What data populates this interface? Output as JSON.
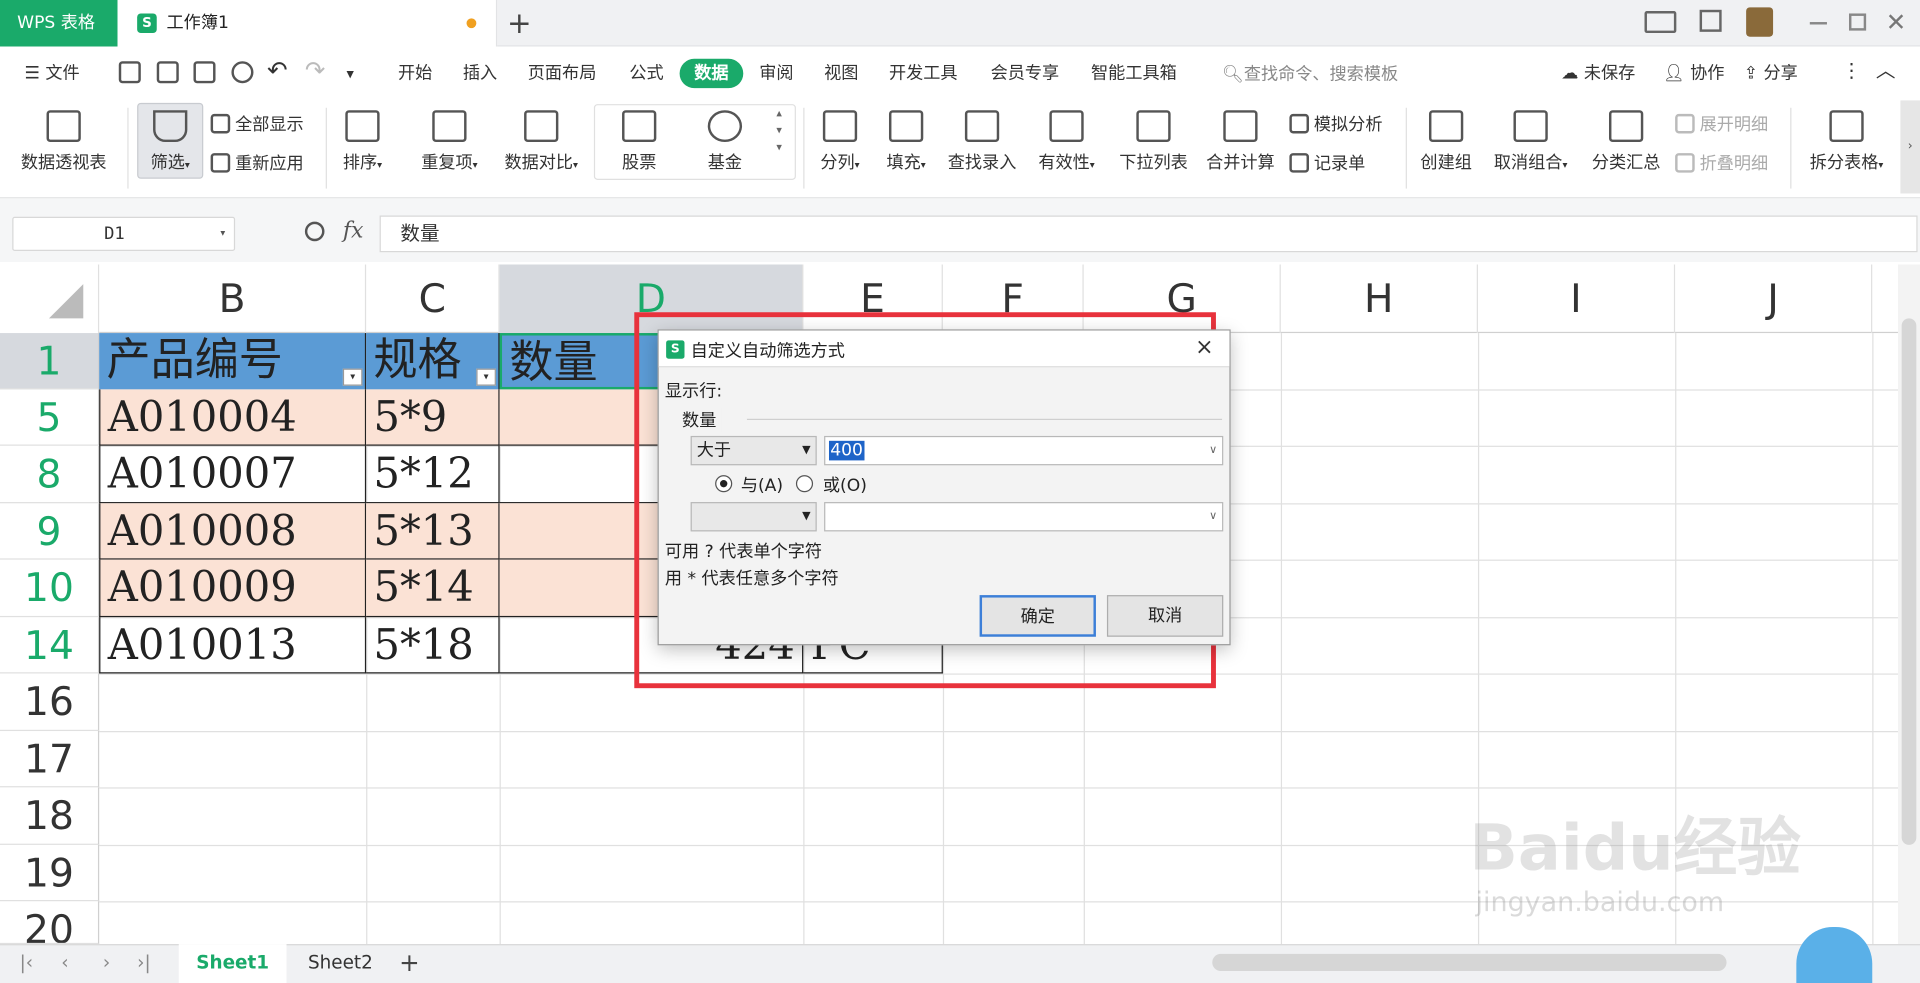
{
  "titlebar": {
    "app_tab": "WPS 表格",
    "doc_tab": "工作簿1",
    "new_tab": "+",
    "doc_icon": "S"
  },
  "menu": {
    "file": "文件",
    "items": [
      "开始",
      "插入",
      "页面布局",
      "公式",
      "数据",
      "审阅",
      "视图",
      "开发工具",
      "会员专享",
      "智能工具箱"
    ],
    "active": "数据",
    "search": "查找命令、搜索模板",
    "unsaved": "未保存",
    "collab": "协作",
    "share": "分享"
  },
  "ribbon": {
    "pivot": "数据透视表",
    "filter": "筛选",
    "show_all": "全部显示",
    "reapply": "重新应用",
    "sort": "排序",
    "duplicates": "重复项",
    "compare": "数据对比",
    "stock": "股票",
    "fund": "基金",
    "split": "分列",
    "fill": "填充",
    "lookup_entry": "查找录入",
    "validity": "有效性",
    "dropdown_list": "下拉列表",
    "merge_calc": "合并计算",
    "simulate": "模拟分析",
    "record_form": "记录单",
    "create_group": "创建组",
    "ungroup": "取消组合",
    "subtotal": "分类汇总",
    "expand_detail": "展开明细",
    "collapse_detail": "折叠明细",
    "split_table": "拆分表格"
  },
  "formula": {
    "cell_ref": "D1",
    "fx": "fx",
    "content": "数量"
  },
  "grid": {
    "columns": [
      "B",
      "C",
      "D",
      "E",
      "F",
      "G",
      "H",
      "I",
      "J"
    ],
    "header_row": {
      "num": "1",
      "b": "产品编号",
      "c": "规格",
      "d": "数量"
    },
    "rows": [
      {
        "num": "5",
        "b": "A010004",
        "c": "5*9"
      },
      {
        "num": "8",
        "b": "A010007",
        "c": "5*12"
      },
      {
        "num": "9",
        "b": "A010008",
        "c": "5*13"
      },
      {
        "num": "10",
        "b": "A010009",
        "c": "5*14"
      },
      {
        "num": "14",
        "b": "A010013",
        "c": "5*18",
        "d": "424",
        "e": "PC"
      }
    ],
    "empty_rows": [
      "16",
      "17",
      "18",
      "19",
      "20"
    ]
  },
  "dialog": {
    "title": "自定义自动筛选方式",
    "show_rows": "显示行:",
    "field": "数量",
    "op1": "大于",
    "val1": "400",
    "and_label": "与(A)",
    "or_label": "或(O)",
    "op2": "",
    "val2": "",
    "hint1": "可用 ? 代表单个字符",
    "hint2": "用 * 代表任意多个字符",
    "ok": "确定",
    "cancel": "取消",
    "close": "×"
  },
  "sheets": {
    "tabs": [
      "Sheet1",
      "Sheet2"
    ],
    "active": "Sheet1",
    "add": "+"
  },
  "watermark": {
    "logo": "Baidu经验",
    "url": "jingyan.baidu.com"
  },
  "colors": {
    "brand": "#1aaa6a",
    "header_fill": "#5b9bd5",
    "row_fill": "#fbe2d5",
    "highlight": "#e8323c"
  }
}
